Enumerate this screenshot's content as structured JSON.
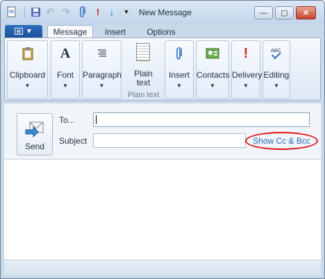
{
  "window": {
    "title": "New Message"
  },
  "qat": {
    "icons": [
      "new-message-icon",
      "save-icon",
      "undo-icon",
      "redo-icon",
      "attach-icon",
      "high-importance-icon",
      "low-importance-icon",
      "customize-icon"
    ]
  },
  "tabs": [
    {
      "label": "Message",
      "active": true
    },
    {
      "label": "Insert",
      "active": false
    },
    {
      "label": "Options",
      "active": false
    }
  ],
  "ribbon": {
    "clipboard": "Clipboard",
    "font": "Font",
    "paragraph": "Paragraph",
    "plain_text": "Plain text",
    "plain_text_group": "Plain text",
    "insert": "Insert",
    "contacts": "Contacts",
    "delivery": "Delivery",
    "editing": "Editing"
  },
  "compose": {
    "send_label": "Send",
    "to_label": "To...",
    "to_value": "",
    "subject_label": "Subject",
    "subject_value": "",
    "show_cc_bcc": "Show Cc & Bcc"
  },
  "colors": {
    "highlight_ring": "#e01515",
    "link": "#2467b9",
    "file_button": "#1c4f98"
  }
}
